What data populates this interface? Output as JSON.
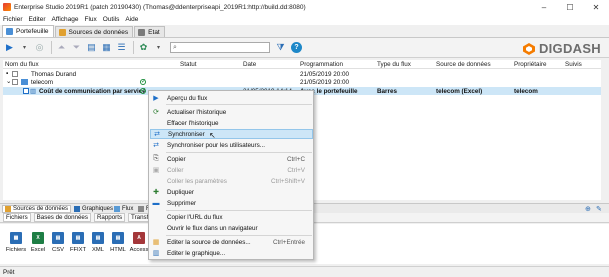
{
  "window": {
    "title": "Enterprise Studio 2019R1 (patch 20190430) (Thomas@ddenterpriseapi_2019R1:http://build.dd:8080)",
    "controls": [
      "–",
      "☐",
      "✕"
    ]
  },
  "menu": [
    "Fichier",
    "Editer",
    "Affichage",
    "Flux",
    "Outils",
    "Aide"
  ],
  "tabs": [
    {
      "label": "Portefeuille"
    },
    {
      "label": "Sources de données"
    },
    {
      "label": "Etat"
    }
  ],
  "logo": {
    "text": "DIGDASH",
    "color": "#6d6d6d",
    "accent": "#f57c00"
  },
  "columns": [
    "Nom du flux",
    "Statut",
    "Date",
    "Programmation",
    "Type du flux",
    "Source de données",
    "Propriétaire",
    "Suivis"
  ],
  "rows": [
    {
      "name": "Thomas Durand",
      "programmation": "21/05/2019 20:00"
    },
    {
      "name": "telecom",
      "programmation": "21/05/2019 20:00"
    },
    {
      "name": "Coût de communication par service",
      "date": "21/05/2019 14:14",
      "programmation": "Avec le portefeuille",
      "type": "Barres",
      "source": "telecom (Excel)",
      "owner": "telecom"
    }
  ],
  "context_menu": [
    {
      "label": "Aperçu du flux",
      "icon": "play-icon",
      "shortcut": ""
    },
    {
      "label": "Actualiser l'historique",
      "icon": "refresh-icon",
      "shortcut": ""
    },
    {
      "label": "Effacer l'historique",
      "icon": "",
      "shortcut": ""
    },
    {
      "label": "Synchroniser",
      "icon": "sync-icon",
      "shortcut": ""
    },
    {
      "label": "Synchroniser pour les utilisateurs...",
      "icon": "sync-users-icon",
      "shortcut": ""
    },
    {
      "label": "Copier",
      "icon": "copy-icon",
      "shortcut": "Ctrl+C"
    },
    {
      "label": "Coller",
      "icon": "paste-icon",
      "shortcut": "Ctrl+V"
    },
    {
      "label": "Coller les paramètres",
      "icon": "",
      "shortcut": "Ctrl+Shift+V"
    },
    {
      "label": "Dupliquer",
      "icon": "duplicate-icon",
      "shortcut": ""
    },
    {
      "label": "Supprimer",
      "icon": "delete-icon",
      "shortcut": ""
    },
    {
      "label": "Copier l'URL du flux",
      "icon": "",
      "shortcut": ""
    },
    {
      "label": "Ouvrir le flux dans un navigateur",
      "icon": "",
      "shortcut": ""
    },
    {
      "label": "Editer la source de données...",
      "icon": "edit-source-icon",
      "shortcut": "Ctrl+Entrée"
    },
    {
      "label": "Editer le graphique...",
      "icon": "edit-chart-icon",
      "shortcut": ""
    }
  ],
  "bottom_tabs": [
    "Sources de données",
    "Graphiques",
    "Flux",
    "F"
  ],
  "sub_tabs": [
    "Fichiers",
    "Bases de données",
    "Rapports",
    "Transformateurs"
  ],
  "source_types": [
    "Fichiers",
    "Excel",
    "CSV",
    "FFIXT",
    "XML",
    "HTML",
    "Access"
  ],
  "status": "Prêt"
}
